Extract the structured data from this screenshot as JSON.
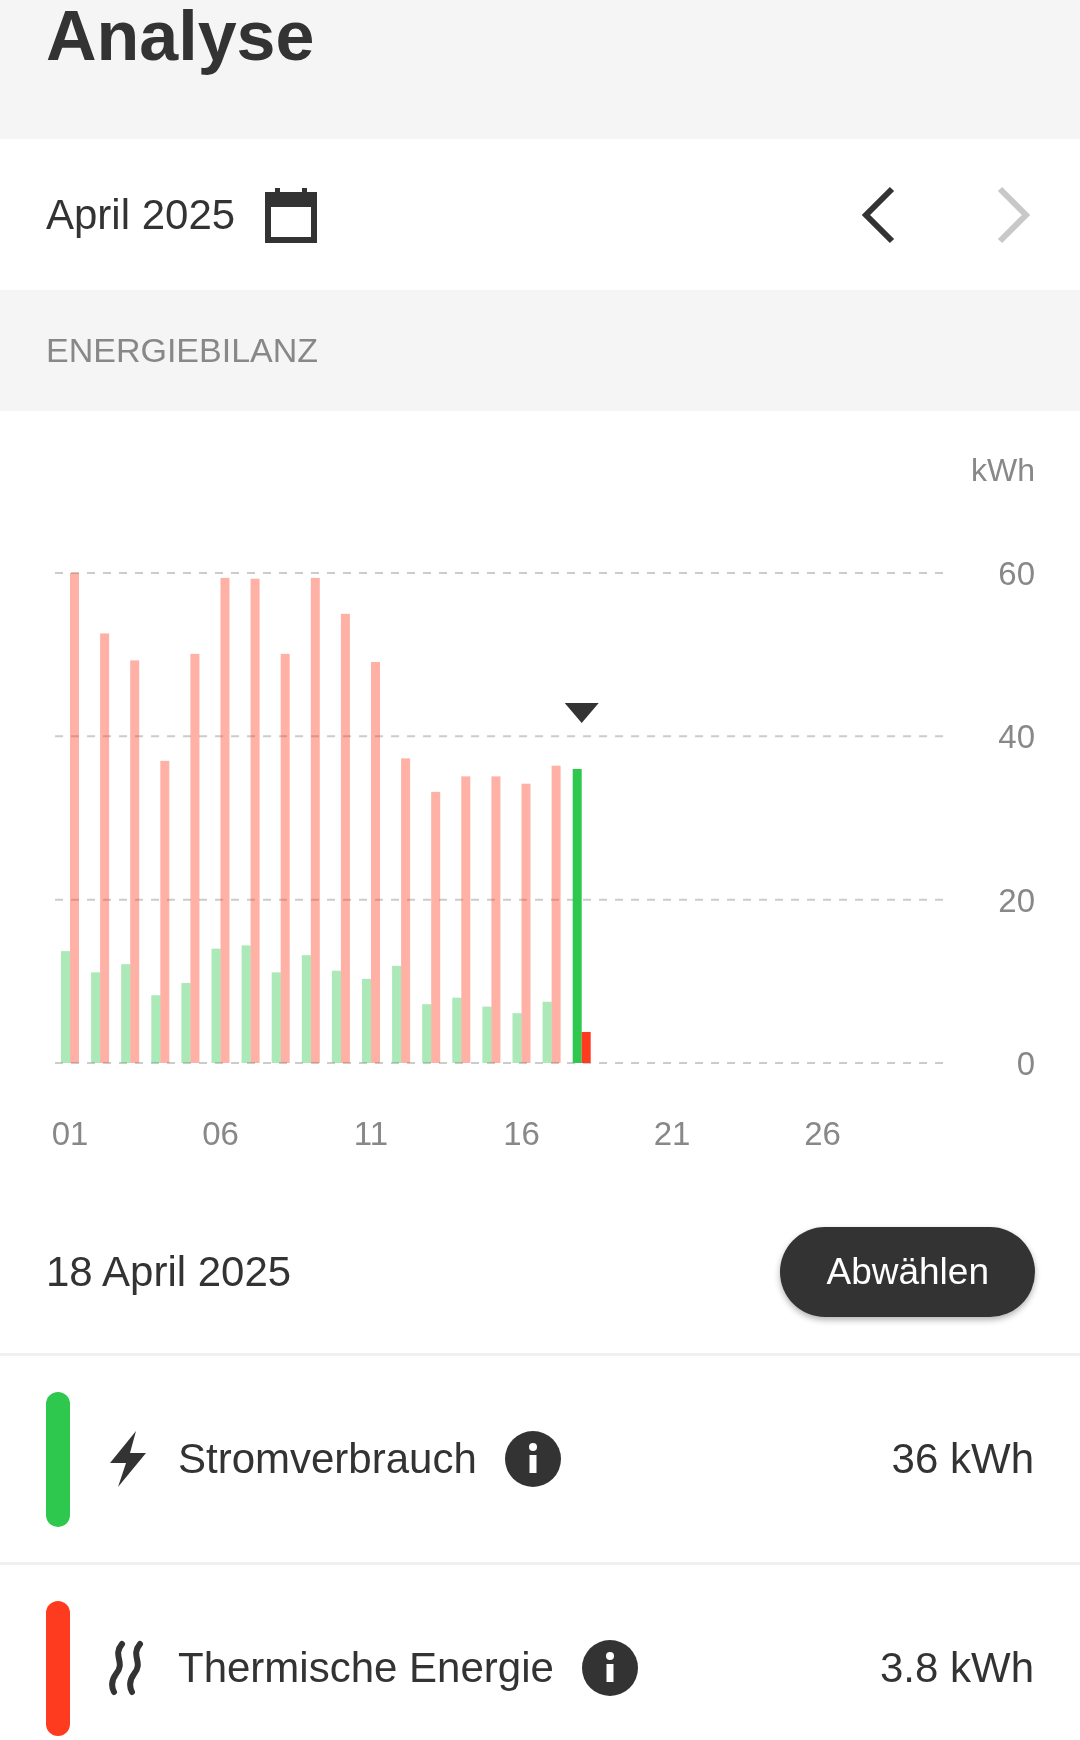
{
  "header": {
    "title": "Analyse"
  },
  "period": {
    "label": "April 2025",
    "prev_enabled": true,
    "next_enabled": false
  },
  "section": {
    "title": "ENERGIEBILANZ"
  },
  "chart": {
    "chart_data": {
      "type": "bar",
      "ylabel": "kWh",
      "x": [
        1,
        2,
        3,
        4,
        5,
        6,
        7,
        8,
        9,
        10,
        11,
        12,
        13,
        14,
        15,
        16,
        17,
        18
      ],
      "series": [
        {
          "color": "#2dc84d",
          "values": [
            13.7,
            11.1,
            12.1,
            8.3,
            9.8,
            14.0,
            14.4,
            11.1,
            13.2,
            11.3,
            10.3,
            11.9,
            7.2,
            8.0,
            6.9,
            6.1,
            7.5,
            36
          ]
        },
        {
          "color": "#ff3b1f",
          "values": [
            60,
            52.6,
            49.3,
            37.0,
            50.1,
            59.4,
            59.3,
            50.1,
            59.4,
            55.0,
            49.1,
            37.3,
            33.2,
            35.1,
            35.1,
            34.2,
            36.4,
            3.8
          ]
        }
      ],
      "xlim": [
        1,
        30
      ],
      "ylim": [
        0,
        60
      ],
      "yticks": [
        0,
        20,
        40,
        60
      ],
      "grid": true,
      "xticks": [
        {
          "value": 1,
          "label": "01"
        },
        {
          "value": 6,
          "label": "06"
        },
        {
          "value": 11,
          "label": "11"
        },
        {
          "value": 16,
          "label": "16"
        },
        {
          "value": 21,
          "label": "21"
        },
        {
          "value": 26,
          "label": "26"
        }
      ]
    },
    "days": [
      {
        "selected": false
      },
      {
        "selected": false
      },
      {
        "selected": false
      },
      {
        "selected": false
      },
      {
        "selected": false
      },
      {
        "selected": false
      },
      {
        "selected": false
      },
      {
        "selected": false
      },
      {
        "selected": false
      },
      {
        "selected": false
      },
      {
        "selected": false
      },
      {
        "selected": false
      },
      {
        "selected": false
      },
      {
        "selected": false
      },
      {
        "selected": false
      },
      {
        "selected": false
      },
      {
        "selected": false
      },
      {
        "selected": true
      }
    ]
  },
  "selection": {
    "date": "18 April 2025",
    "button": "Abwählen"
  },
  "items": [
    {
      "kind": "power",
      "name": "Stromverbrauch",
      "value": "36 kWh",
      "color": "#2dc84d"
    },
    {
      "kind": "heat",
      "name": "Thermische Energie",
      "value": "3.8 kWh",
      "color": "#ff3b1f"
    }
  ]
}
